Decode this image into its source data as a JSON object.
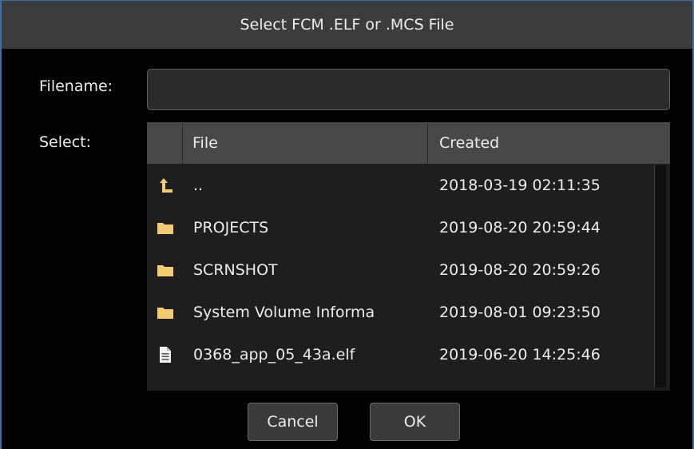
{
  "dialog": {
    "title": "Select FCM .ELF or .MCS File"
  },
  "filename": {
    "label": "Filename:",
    "value": "",
    "placeholder": ""
  },
  "select": {
    "label": "Select:"
  },
  "list": {
    "columns": {
      "file": "File",
      "created": "Created"
    },
    "rows": [
      {
        "icon": "parent-directory-icon",
        "name": "..",
        "created": "2018-03-19 02:11:35"
      },
      {
        "icon": "folder-icon",
        "name": "PROJECTS",
        "created": "2019-08-20 20:59:44"
      },
      {
        "icon": "folder-icon",
        "name": "SCRNSHOT",
        "created": "2019-08-20 20:59:26"
      },
      {
        "icon": "folder-icon",
        "name": "System Volume Informa",
        "created": "2019-08-01 09:23:50"
      },
      {
        "icon": "file-icon",
        "name": "0368_app_05_43a.elf",
        "created": "2019-06-20 14:25:46"
      }
    ]
  },
  "buttons": {
    "cancel": "Cancel",
    "ok": "OK"
  },
  "colors": {
    "folder": "#f2cb72",
    "window_border": "#3c6fa8",
    "titlebar": "#3c3c3c",
    "header": "#484848",
    "list_bg": "#1e1e1e"
  }
}
